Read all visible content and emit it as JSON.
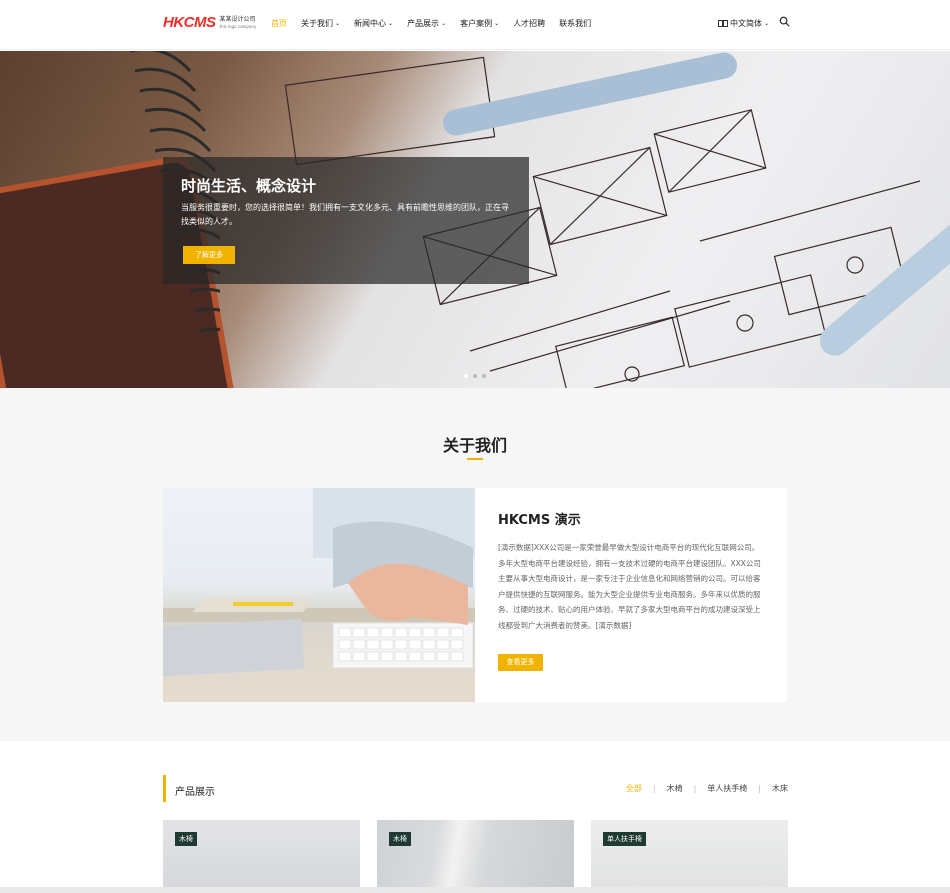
{
  "header": {
    "logo_mark": "HKCMS",
    "logo_cn": "某某设计公司",
    "logo_en": "this logo company",
    "nav": [
      {
        "label": "首页",
        "dropdown": false
      },
      {
        "label": "关于我们",
        "dropdown": true
      },
      {
        "label": "新闻中心",
        "dropdown": true
      },
      {
        "label": "产品展示",
        "dropdown": true
      },
      {
        "label": "客户案例",
        "dropdown": true
      },
      {
        "label": "人才招聘",
        "dropdown": false
      },
      {
        "label": "联系我们",
        "dropdown": false
      }
    ],
    "language": "中文简体",
    "accent_color": "#f0b400"
  },
  "hero": {
    "title": "时尚生活、概念设计",
    "description": "当服务很重要时，您的选择很简单！我们拥有一支文化多元、具有前瞻性思维的团队，正在寻找类似的人才。",
    "button": "了解更多"
  },
  "about": {
    "title": "关于我们",
    "heading": "HKCMS 演示",
    "text": "[演示数据]XXX公司是一家荣誉最早做大型设计电商平台的现代化互联网公司。多年大型电商平台建设经验，拥有一支技术过硬的电商平台建设团队。XXX公司主要从事大型电商设计，是一家专注于企业信息化和网络营销的公司。可以给客户提供快捷的互联网服务。能为大型企业提供专业电商服务。多年来以优质的服务、过硬的技术、贴心的用户体验、早就了多家大型电商平台的成功建设深受上线都受到广大消费者的赞美。[演示数据]",
    "button": "查看更多"
  },
  "products": {
    "title": "产品展示",
    "tabs": [
      "全部",
      "木椅",
      "单人扶手椅",
      "木床"
    ],
    "cards": [
      {
        "tag": "木椅"
      },
      {
        "tag": "木椅"
      },
      {
        "tag": "单人扶手椅"
      }
    ]
  }
}
